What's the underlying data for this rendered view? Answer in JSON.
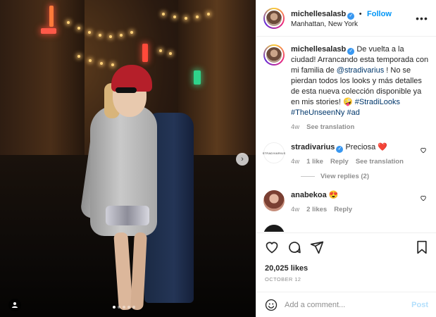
{
  "post": {
    "username": "michellesalasb",
    "follow_label": "Follow",
    "separator": "•",
    "location": "Manhattan, New York",
    "more_icon": "more-horizontal-icon",
    "carousel": {
      "next_icon": "chevron-right-icon",
      "slide_count": 5,
      "active_slide": 1,
      "tag_icon": "user-tag-icon"
    }
  },
  "caption": {
    "username": "michellesalasb",
    "text_before": "De vuelta a la ciudad! Arrancando esta temporada con mi familia de ",
    "mention": "@stradivarius",
    "text_after": " ! No se pierdan todos los looks y más detalles de esta nueva colección disponible ya en mis stories! 🤪",
    "hashtags": "#StradiLooks #TheUnseenNy #ad",
    "time": "4w",
    "see_translation": "See translation"
  },
  "comments": [
    {
      "username": "stradivarius",
      "avatar_text": "STRADIVARIUS",
      "text": "Preciosa ❤️",
      "time": "4w",
      "likes": "1 like",
      "reply": "Reply",
      "see_translation": "See translation",
      "view_replies": "View replies (2)"
    },
    {
      "username": "anabekoa",
      "text": "😍",
      "time": "4w",
      "likes": "2 likes",
      "reply": "Reply"
    },
    {
      "username": "",
      "text": "",
      "partial": true
    }
  ],
  "actions": {
    "like_icon": "heart-icon",
    "comment_icon": "comment-icon",
    "share_icon": "share-icon",
    "save_icon": "bookmark-icon",
    "likes_count": "20,025 likes",
    "date": "OCTOBER 12"
  },
  "add_comment": {
    "emoji_icon": "emoji-icon",
    "placeholder": "Add a comment...",
    "post_label": "Post"
  },
  "colors": {
    "follow_blue": "#0095f6",
    "mention_blue": "#00376b",
    "muted": "#8e8e8e",
    "post_disabled": "#b2dffc",
    "verified": "#3897f0"
  }
}
